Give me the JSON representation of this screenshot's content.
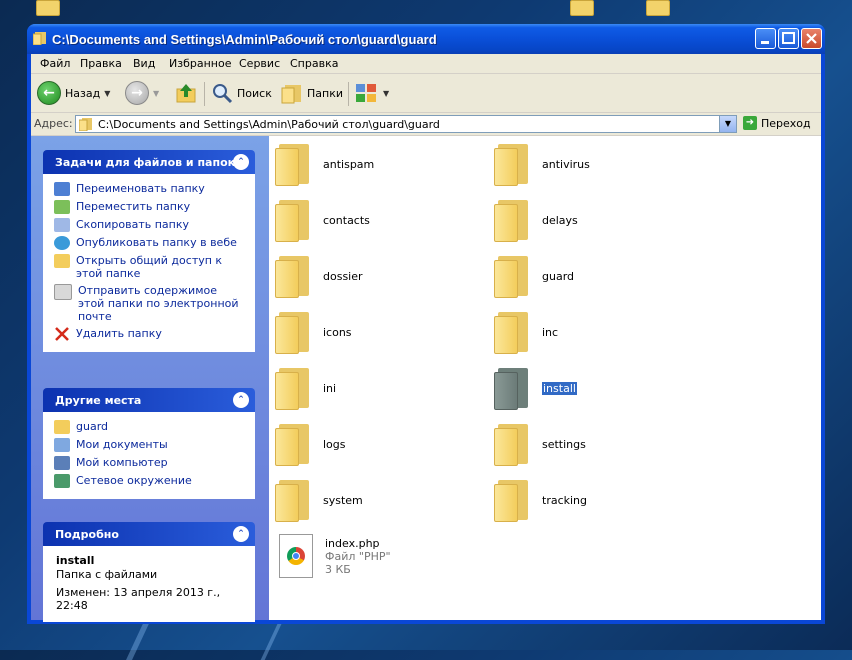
{
  "window": {
    "title": "C:\\Documents and Settings\\Admin\\Рабочий стол\\guard\\guard"
  },
  "menu": [
    "Файл",
    "Правка",
    "Вид",
    "Избранное",
    "Сервис",
    "Справка"
  ],
  "toolbar": {
    "back_label": "Назад",
    "search_label": "Поиск",
    "folders_label": "Папки"
  },
  "address": {
    "label": "Адрес:",
    "value": "C:\\Documents and Settings\\Admin\\Рабочий стол\\guard\\guard",
    "go_label": "Переход"
  },
  "tasks_panel": {
    "title": "Задачи для файлов и папок",
    "items": [
      {
        "label": "Переименовать папку",
        "icon": "rename-icon"
      },
      {
        "label": "Переместить папку",
        "icon": "move-icon"
      },
      {
        "label": "Скопировать папку",
        "icon": "copy-icon"
      },
      {
        "label": "Опубликовать папку в вебе",
        "icon": "web-publish-icon"
      },
      {
        "label": "Открыть общий доступ к этой папке",
        "icon": "share-icon"
      },
      {
        "label": "Отправить содержимое этой папки по электронной почте",
        "icon": "email-icon"
      },
      {
        "label": "Удалить папку",
        "icon": "delete-icon"
      }
    ]
  },
  "places_panel": {
    "title": "Другие места",
    "items": [
      {
        "label": "guard",
        "icon": "folder-icon"
      },
      {
        "label": "Мои документы",
        "icon": "my-documents-icon"
      },
      {
        "label": "Мой компьютер",
        "icon": "my-computer-icon"
      },
      {
        "label": "Сетевое окружение",
        "icon": "network-icon"
      }
    ]
  },
  "details_panel": {
    "title": "Подробно",
    "name": "install",
    "type": "Папка с файлами",
    "modified": "Изменен: 13 апреля 2013 г., 22:48"
  },
  "files": [
    {
      "name": "antispam",
      "kind": "folder"
    },
    {
      "name": "antivirus",
      "kind": "folder"
    },
    {
      "name": "contacts",
      "kind": "folder"
    },
    {
      "name": "delays",
      "kind": "folder"
    },
    {
      "name": "dossier",
      "kind": "folder"
    },
    {
      "name": "guard",
      "kind": "folder"
    },
    {
      "name": "icons",
      "kind": "folder"
    },
    {
      "name": "inc",
      "kind": "folder"
    },
    {
      "name": "ini",
      "kind": "folder"
    },
    {
      "name": "install",
      "kind": "folder",
      "selected": true
    },
    {
      "name": "logs",
      "kind": "folder"
    },
    {
      "name": "settings",
      "kind": "folder"
    },
    {
      "name": "system",
      "kind": "folder"
    },
    {
      "name": "tracking",
      "kind": "folder"
    }
  ],
  "php_file": {
    "name": "index.php",
    "type": "Файл \"PHP\"",
    "size": "3 КБ"
  },
  "colors": {
    "titlebar": "#0a4fd8",
    "selection": "#316ac5",
    "task_link": "#0c2a9c"
  }
}
